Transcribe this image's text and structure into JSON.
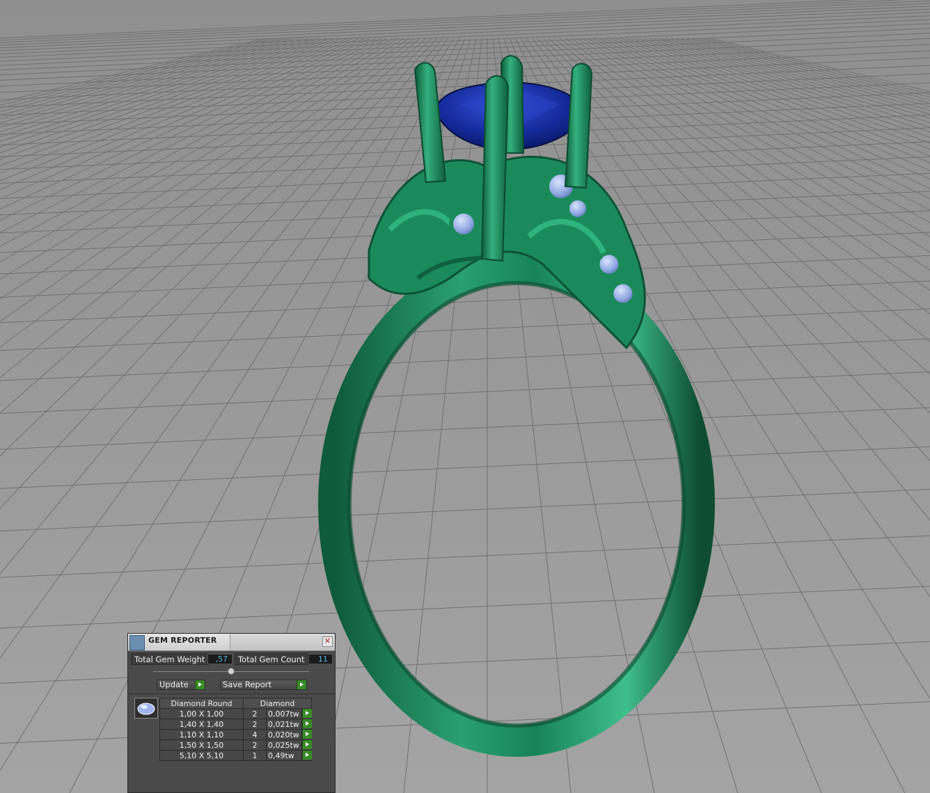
{
  "scene": {
    "object": "ring-3d-model",
    "colors": {
      "background": "#9c9c9c",
      "grid_line": "#6e6e6e",
      "metal": "#1f8a5c",
      "center_stone": "#1a2f9c",
      "side_stones": "#8fa8e0"
    }
  },
  "gem_reporter": {
    "title": "GEM REPORTER",
    "close_icon": "close-icon",
    "total_gem_weight_label": "Total Gem Weight",
    "total_gem_weight_value": ",57",
    "total_gem_count_label": "Total Gem Count",
    "total_gem_count_value": "11",
    "update_label": "Update",
    "save_report_label": "Save Report",
    "gem_icon": "oval-gem-icon",
    "table": {
      "headers": [
        "Diamond Round",
        "Diamond"
      ],
      "rows": [
        {
          "size": "1,00 X 1,00",
          "count": "2",
          "weight": "0,007tw"
        },
        {
          "size": "1,40 X 1,40",
          "count": "2",
          "weight": "0,021tw"
        },
        {
          "size": "1,10 X 1,10",
          "count": "4",
          "weight": "0,020tw"
        },
        {
          "size": "1,50 X 1,50",
          "count": "2",
          "weight": "0,025tw"
        },
        {
          "size": "5,10 X 5,10",
          "count": "1",
          "weight": "0,49tw"
        }
      ]
    }
  }
}
